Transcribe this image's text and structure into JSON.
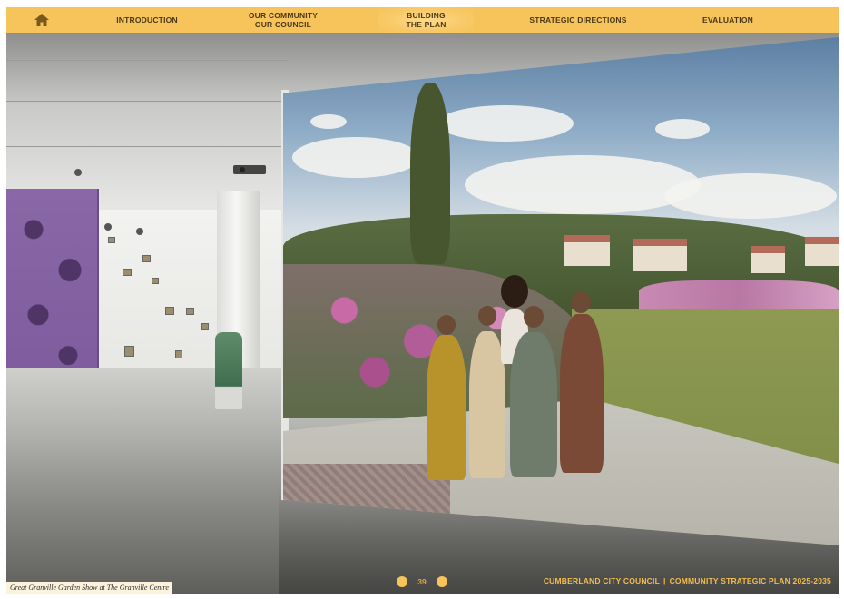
{
  "nav": {
    "home_icon": "home-icon",
    "items": [
      {
        "label": "INTRODUCTION"
      },
      {
        "label": "OUR COMMUNITY\nOUR COUNCIL"
      },
      {
        "label": "BUILDING\nTHE PLAN",
        "active": true
      },
      {
        "label": "STRATEGIC DIRECTIONS"
      },
      {
        "label": "EVALUATION"
      }
    ],
    "accent": "#f6c45a"
  },
  "caption": "Great Granville Garden Show at The Granville Centre",
  "pager": {
    "page": "39",
    "prev_icon": "circle-prev-icon",
    "next_icon": "circle-next-icon"
  },
  "footer": {
    "org": "CUMBERLAND CITY COUNCIL",
    "separator": "|",
    "doc": "COMMUNITY STRATEGIC PLAN 2025-2035"
  }
}
